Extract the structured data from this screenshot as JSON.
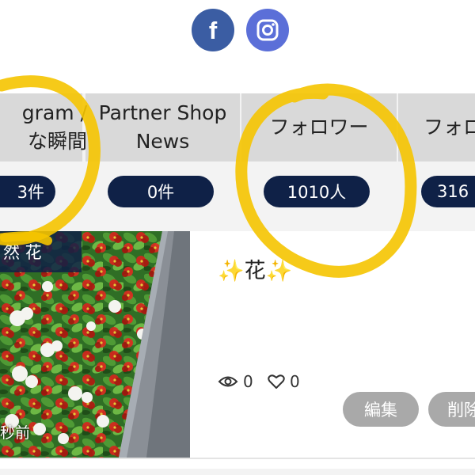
{
  "social": {
    "facebook_glyph": "f",
    "facebook_icon": "facebook-icon",
    "instagram_icon": "instagram-icon",
    "facebook_color": "#3b5da3",
    "instagram_color": "#5b6fd8"
  },
  "stats": {
    "tabs": [
      {
        "label": "gram /\nな瞬間",
        "count": "3件"
      },
      {
        "label": "Partner Shop\nNews",
        "count": "0件"
      },
      {
        "label": "フォロワー",
        "count": "1010人"
      },
      {
        "label": "フォロ",
        "count": "316"
      }
    ],
    "pill_color": "#0f2147"
  },
  "post": {
    "category_label": "然 花",
    "time_label": "秒前",
    "title": "✨花✨",
    "views": "0",
    "likes": "0",
    "edit_label": "編集",
    "delete_label": "削除",
    "view_icon": "eye-icon",
    "like_icon": "heart-icon"
  },
  "annotation": {
    "marker_color": "#f5c400"
  }
}
